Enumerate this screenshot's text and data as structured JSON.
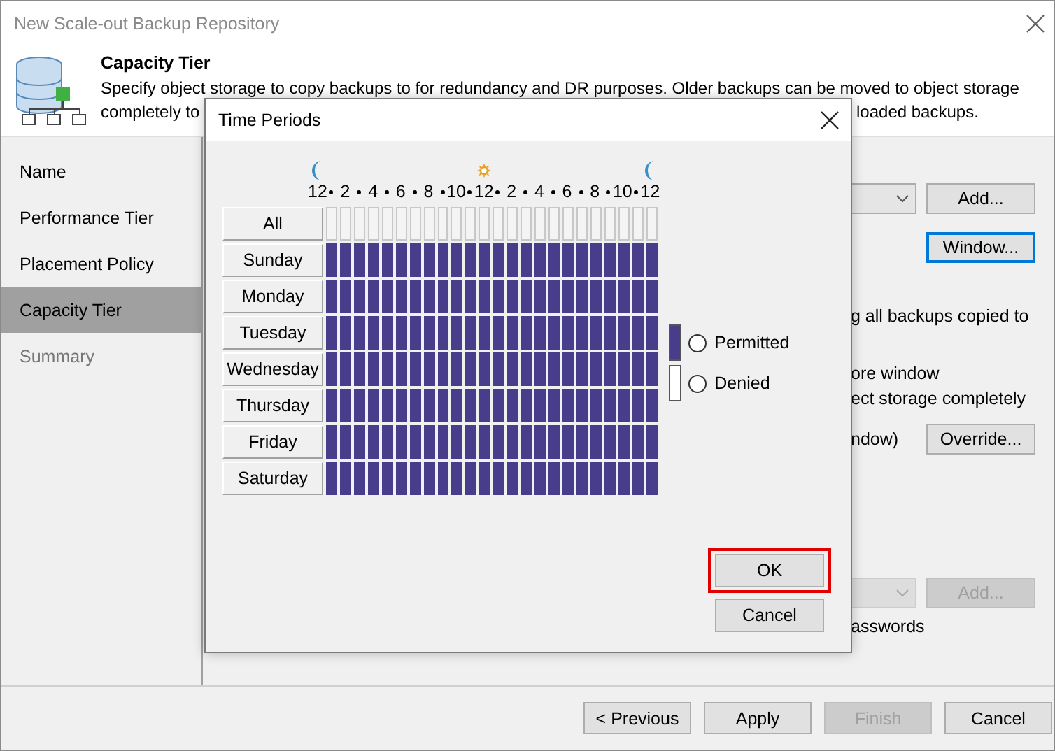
{
  "window": {
    "title": "New Scale-out Backup Repository"
  },
  "header": {
    "title": "Capacity Tier",
    "line_1": "Specify object storage to copy backups to for redundancy and DR purposes. Older backups can be moved to object storage",
    "line_2_start": "completely to",
    "line_2_end": "loaded backups."
  },
  "sidebar": {
    "items": [
      {
        "label": "Name",
        "selected": false,
        "disabled": false
      },
      {
        "label": "Performance Tier",
        "selected": false,
        "disabled": false
      },
      {
        "label": "Placement Policy",
        "selected": false,
        "disabled": false
      },
      {
        "label": "Capacity Tier",
        "selected": true,
        "disabled": false
      },
      {
        "label": "Summary",
        "selected": false,
        "disabled": true
      }
    ]
  },
  "pane": {
    "storage_combo": {
      "disabled": false
    },
    "add_button": {
      "label": "Add...",
      "disabled": false
    },
    "window_button": {
      "label": "Window...",
      "focused": true
    },
    "text_1": "g all backups copied to",
    "text_2": "ore window",
    "text_3": "ect storage completely",
    "text_4": "ndow)",
    "override_button": {
      "label": "Override...",
      "disabled": false
    },
    "second_combo": {
      "disabled": true
    },
    "second_add_button": {
      "label": "Add...",
      "disabled": true
    },
    "text_5": "asswords"
  },
  "footer": {
    "buttons": [
      {
        "label": "< Previous",
        "disabled": false
      },
      {
        "label": "Apply",
        "disabled": false
      },
      {
        "label": "Finish",
        "disabled": true
      },
      {
        "label": "Cancel",
        "disabled": false
      }
    ]
  },
  "dialog": {
    "title": "Time Periods",
    "hour_ticks": [
      "12",
      "2",
      "4",
      "6",
      "8",
      "10",
      "12",
      "2",
      "4",
      "6",
      "8",
      "10",
      "12"
    ],
    "all_label": "All",
    "days": [
      {
        "label": "Sunday",
        "hours": [
          true,
          true,
          true,
          true,
          true,
          true,
          true,
          true,
          true,
          true,
          true,
          true,
          true,
          true,
          true,
          true,
          true,
          true,
          true,
          true,
          true,
          true,
          true,
          true
        ]
      },
      {
        "label": "Monday",
        "hours": [
          true,
          true,
          true,
          true,
          true,
          true,
          true,
          true,
          true,
          true,
          true,
          true,
          true,
          true,
          true,
          true,
          true,
          true,
          true,
          true,
          true,
          true,
          true,
          true
        ]
      },
      {
        "label": "Tuesday",
        "hours": [
          true,
          true,
          true,
          true,
          true,
          true,
          true,
          true,
          true,
          true,
          true,
          true,
          true,
          true,
          true,
          true,
          true,
          true,
          true,
          true,
          true,
          true,
          true,
          true
        ]
      },
      {
        "label": "Wednesday",
        "hours": [
          true,
          true,
          true,
          true,
          true,
          true,
          true,
          true,
          true,
          true,
          true,
          true,
          true,
          true,
          true,
          true,
          true,
          true,
          true,
          true,
          true,
          true,
          true,
          true
        ]
      },
      {
        "label": "Thursday",
        "hours": [
          true,
          true,
          true,
          true,
          true,
          true,
          true,
          true,
          true,
          true,
          true,
          true,
          true,
          true,
          true,
          true,
          true,
          true,
          true,
          true,
          true,
          true,
          true,
          true
        ]
      },
      {
        "label": "Friday",
        "hours": [
          true,
          true,
          true,
          true,
          true,
          true,
          true,
          true,
          true,
          true,
          true,
          true,
          true,
          true,
          true,
          true,
          true,
          true,
          true,
          true,
          true,
          true,
          true,
          true
        ]
      },
      {
        "label": "Saturday",
        "hours": [
          true,
          true,
          true,
          true,
          true,
          true,
          true,
          true,
          true,
          true,
          true,
          true,
          true,
          true,
          true,
          true,
          true,
          true,
          true,
          true,
          true,
          true,
          true,
          true
        ]
      }
    ],
    "legend": [
      {
        "label": "Permitted",
        "kind": "permitted",
        "selected": false
      },
      {
        "label": "Denied",
        "kind": "denied",
        "selected": false
      }
    ],
    "buttons": [
      {
        "label": "OK",
        "highlighted": true
      },
      {
        "label": "Cancel",
        "highlighted": false
      }
    ]
  }
}
